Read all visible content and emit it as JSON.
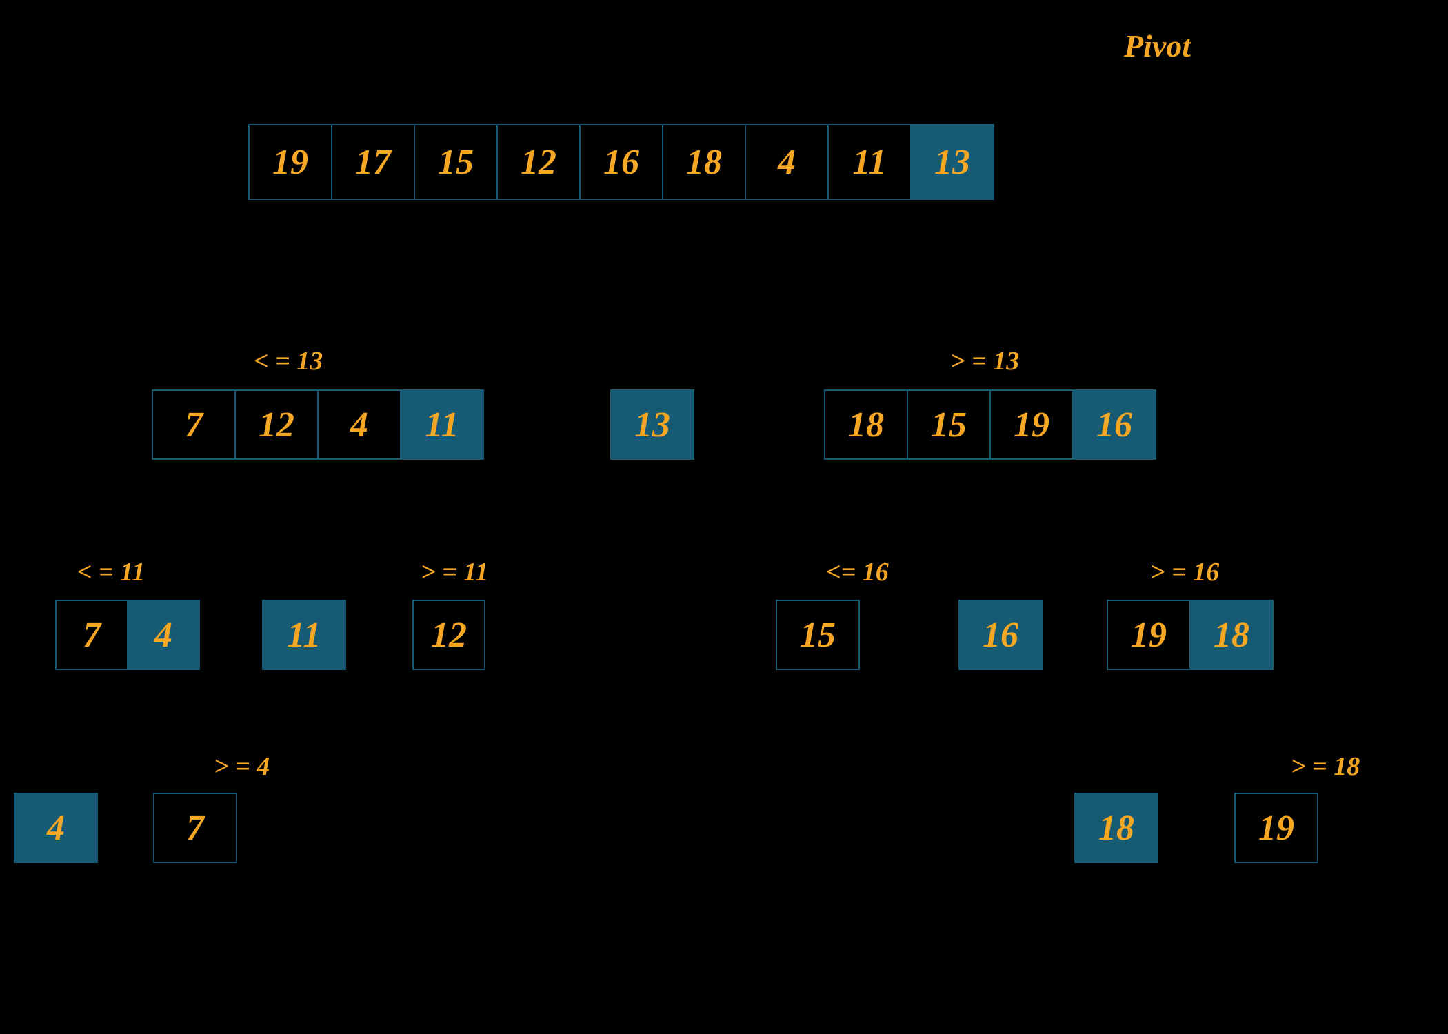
{
  "pivot_label": "Pivot",
  "row1": [
    "19",
    "17",
    "15",
    "12",
    "16",
    "18",
    "4",
    "11",
    "13"
  ],
  "row2": {
    "left_label": "< = 13",
    "left": [
      "7",
      "12",
      "4",
      "11"
    ],
    "mid": [
      "13"
    ],
    "right_label": "> = 13",
    "right": [
      "18",
      "15",
      "19",
      "16"
    ]
  },
  "row3": {
    "a_label": "< = 11",
    "a": [
      "7",
      "4"
    ],
    "b": [
      "11"
    ],
    "c_label": "> = 11",
    "c": [
      "12"
    ],
    "d_label": "<= 16",
    "d": [
      "15"
    ],
    "e": [
      "16"
    ],
    "f_label": "> = 16",
    "f": [
      "19",
      "18"
    ]
  },
  "row4": {
    "a": [
      "4"
    ],
    "b_label": "> = 4",
    "b": [
      "7"
    ],
    "c": [
      "18"
    ],
    "d_label": "> = 18",
    "d": [
      "19"
    ]
  }
}
